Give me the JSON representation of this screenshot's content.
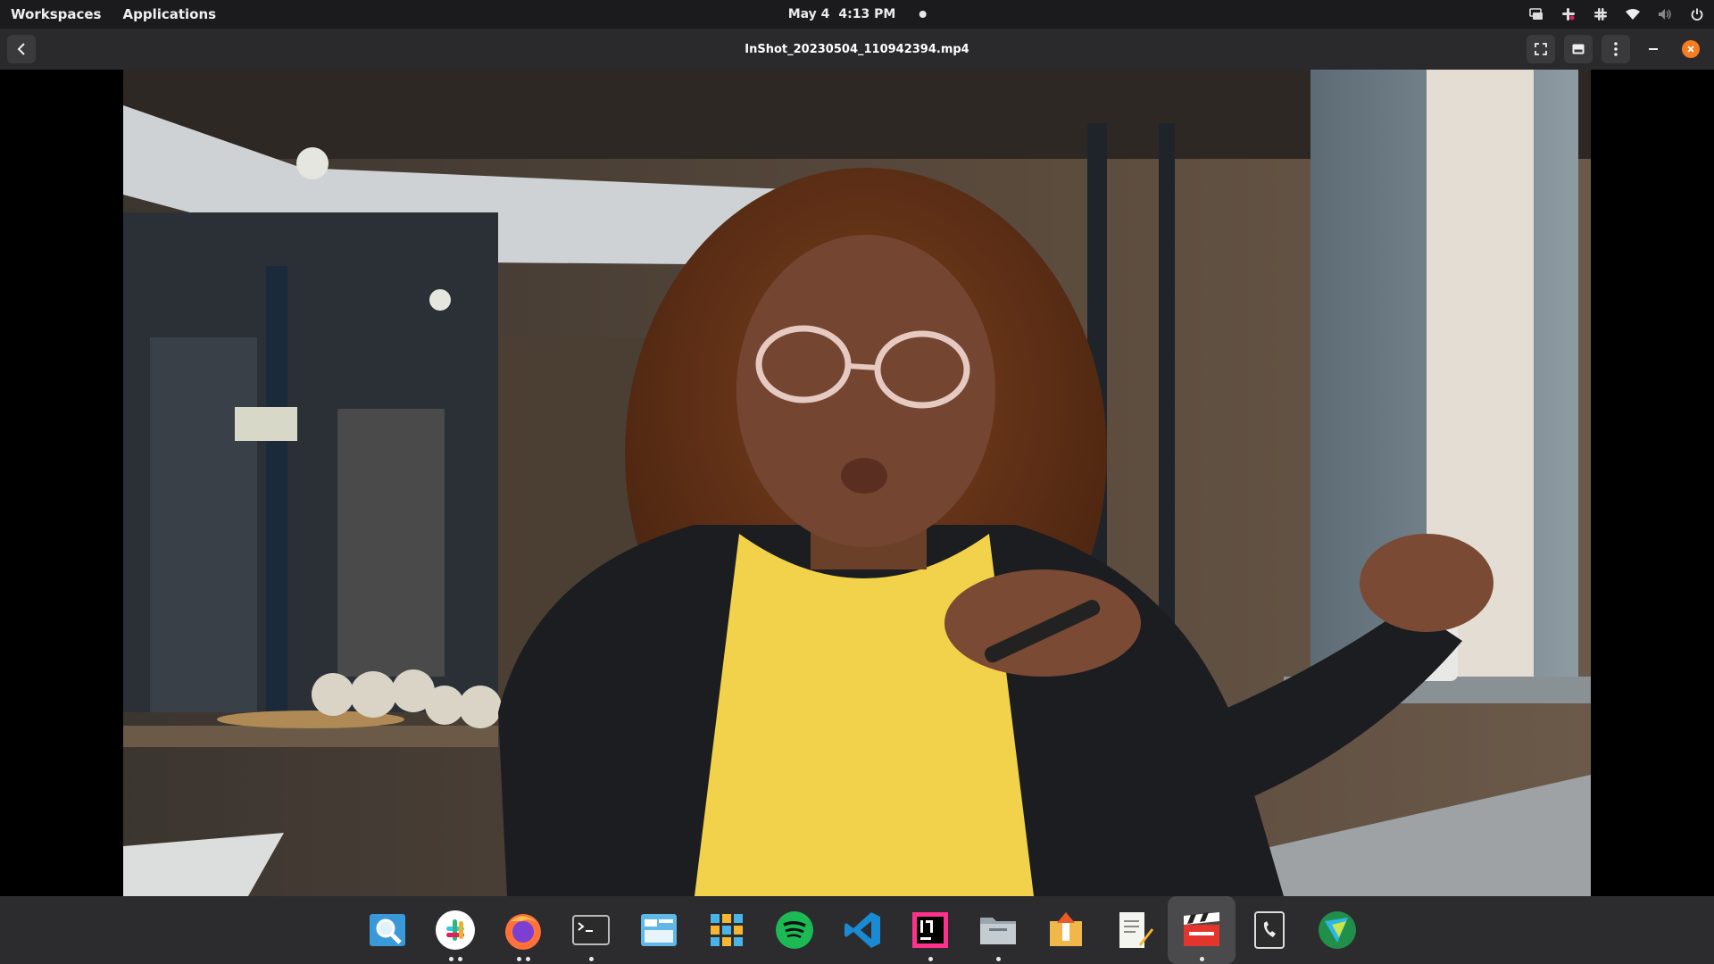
{
  "top_panel": {
    "workspaces_label": "Workspaces",
    "applications_label": "Applications",
    "date": "May 4",
    "time": "4:13 PM",
    "tray_icons": [
      "screen-share-icon",
      "slack-tray-icon",
      "slack-tray-icon-2",
      "wifi-icon",
      "volume-muted-icon",
      "power-icon"
    ]
  },
  "player": {
    "title": "InShot_20230504_110942394.mp4",
    "buttons": [
      "back-icon",
      "fullscreen-icon",
      "subtitles-icon",
      "menu-dots-icon",
      "minimize-icon",
      "close-icon"
    ]
  },
  "dock": {
    "apps": [
      {
        "name": "search-app-icon",
        "running": 0
      },
      {
        "name": "slack-app-icon",
        "running": 2
      },
      {
        "name": "firefox-app-icon",
        "running": 2
      },
      {
        "name": "terminal-app-icon",
        "running": 1
      },
      {
        "name": "text-editor-app-icon",
        "running": 0
      },
      {
        "name": "app-grid-icon",
        "running": 0
      },
      {
        "name": "spotify-app-icon",
        "running": 0
      },
      {
        "name": "vscode-app-icon",
        "running": 0
      },
      {
        "name": "intellij-app-icon",
        "running": 1
      },
      {
        "name": "files-app-icon",
        "running": 1
      },
      {
        "name": "installer-app-icon",
        "running": 0
      },
      {
        "name": "notes-app-icon",
        "running": 0
      },
      {
        "name": "video-player-app-icon",
        "running": 1,
        "active": true
      },
      {
        "name": "phone-app-icon",
        "running": 0
      },
      {
        "name": "maps-app-icon",
        "running": 0
      }
    ]
  }
}
